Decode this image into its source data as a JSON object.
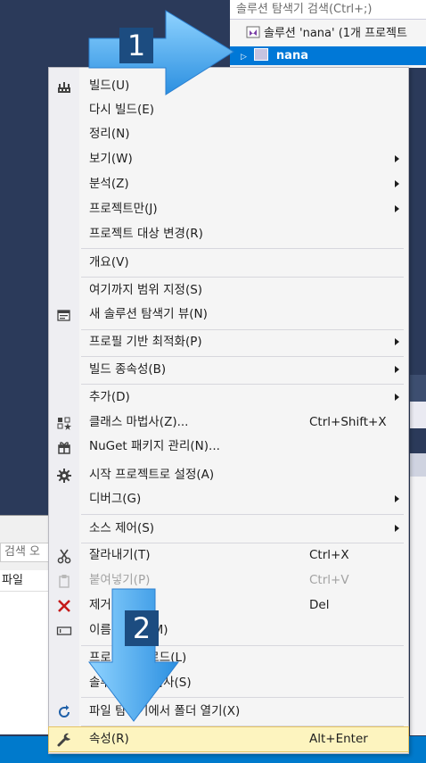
{
  "solution_explorer": {
    "search_placeholder": "솔루션 탐색기 검색(Ctrl+;)",
    "solution_label": "솔루션 'nana' (1개 프로젝트",
    "project_label": "nana"
  },
  "left_panel": {
    "search_placeholder": "검색 오",
    "column_header": "파일"
  },
  "context_menu": {
    "items": [
      {
        "label": "빌드(U)",
        "icon": "build-icon"
      },
      {
        "label": "다시 빌드(E)"
      },
      {
        "label": "정리(N)"
      },
      {
        "label": "보기(W)",
        "submenu": true
      },
      {
        "label": "분석(Z)",
        "submenu": true
      },
      {
        "label": "프로젝트만(J)",
        "submenu": true
      },
      {
        "label": "프로젝트 대상 변경(R)"
      },
      {
        "label": "개요(V)"
      },
      {
        "label": "여기까지 범위 지정(S)"
      },
      {
        "label": "새 솔루션 탐색기 뷰(N)",
        "icon": "new-view-icon"
      },
      {
        "label": "프로필 기반 최적화(P)",
        "submenu": true
      },
      {
        "label": "빌드 종속성(B)",
        "submenu": true
      },
      {
        "label": "추가(D)",
        "submenu": true
      },
      {
        "label": "클래스 마법사(Z)...",
        "shortcut": "Ctrl+Shift+X",
        "icon": "class-wizard-icon"
      },
      {
        "label": "NuGet 패키지 관리(N)...",
        "icon": "nuget-package-icon"
      },
      {
        "label": "시작 프로젝트로 설정(A)",
        "icon": "gear-icon"
      },
      {
        "label": "디버그(G)",
        "submenu": true
      },
      {
        "label": "소스 제어(S)",
        "submenu": true
      },
      {
        "label": "잘라내기(T)",
        "shortcut": "Ctrl+X",
        "icon": "scissors-icon"
      },
      {
        "label": "붙여넣기(P)",
        "shortcut": "Ctrl+V",
        "icon": "paste-icon",
        "disabled": true
      },
      {
        "label": "제거",
        "shortcut": "Del",
        "icon": "delete-x-icon"
      },
      {
        "label": "이름 바꾸기(M)",
        "icon": "rename-icon"
      },
      {
        "label": "프로젝트 언로드(L)"
      },
      {
        "label": "솔루션 다시 검사(S)"
      },
      {
        "label": "파일 탐색기에서 폴더 열기(X)",
        "icon": "open-folder-arrow-icon"
      },
      {
        "label": "속성(R)",
        "shortcut": "Alt+Enter",
        "icon": "wrench-icon",
        "highlighted": true
      }
    ]
  },
  "callouts": {
    "step1": "1",
    "step2": "2"
  },
  "colors": {
    "selection": "#0078d7",
    "highlight": "#fdf4bf",
    "arrow": "#3aa9f0",
    "badge": "#1c4c80",
    "status_bar": "#007acc"
  }
}
